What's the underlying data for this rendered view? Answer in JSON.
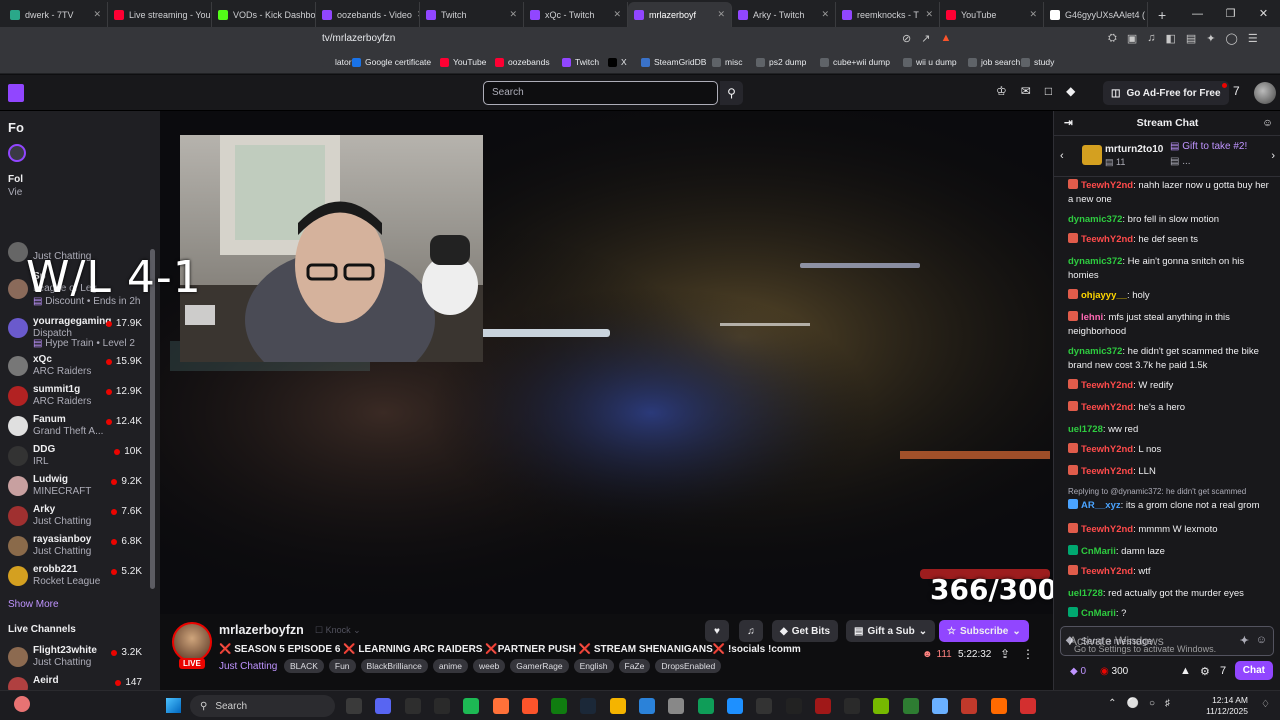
{
  "browser": {
    "tabs": [
      {
        "label": "dwerk - 7TV",
        "color": "#2aa889"
      },
      {
        "label": "Live streaming - You",
        "color": "#ff0033"
      },
      {
        "label": "VODs - Kick Dashbo",
        "color": "#53fc18"
      },
      {
        "label": "oozebands - Video",
        "color": "#9146ff"
      },
      {
        "label": "Twitch",
        "color": "#9146ff"
      },
      {
        "label": "xQc - Twitch",
        "color": "#9146ff"
      },
      {
        "label": "mrlazerboyf",
        "color": "#9146ff"
      },
      {
        "label": "Arky - Twitch",
        "color": "#9146ff"
      },
      {
        "label": "reemknocks - T",
        "color": "#9146ff"
      },
      {
        "label": "YouTube",
        "color": "#ff0033"
      },
      {
        "label": "G46gyyUXsAAlet4 (",
        "color": "#ffffff"
      }
    ],
    "url": "tv/mrlazerboyfzn",
    "bookmarks": [
      {
        "label": "lator",
        "color": "#35363a"
      },
      {
        "label": "Google certificate",
        "color": "#1a73e8"
      },
      {
        "label": "YouTube",
        "color": "#ff0033"
      },
      {
        "label": "oozebands",
        "color": "#ff0033"
      },
      {
        "label": "Twitch",
        "color": "#9146ff"
      },
      {
        "label": "X",
        "color": "#000000"
      },
      {
        "label": "SteamGridDB",
        "color": "#3a72c9"
      },
      {
        "label": "misc",
        "color": "#5f6368"
      },
      {
        "label": "ps2 dump",
        "color": "#5f6368"
      },
      {
        "label": "cube+wii dump",
        "color": "#5f6368"
      },
      {
        "label": "wii u dump",
        "color": "#5f6368"
      },
      {
        "label": "job search",
        "color": "#5f6368"
      },
      {
        "label": "study",
        "color": "#5f6368"
      }
    ]
  },
  "header": {
    "search_placeholder": "Search",
    "ad_free": "Go Ad-Free for Free"
  },
  "sidebar": {
    "followed_label": "Fo",
    "fol_label": "Fol",
    "vie_label": "Vie",
    "just_chatting_top": "Just Chatting",
    "sp_label": "Sp",
    "league": "League of Leg",
    "discount": "Discount • Ends in 2h",
    "channels": [
      {
        "name": "yourragegaming",
        "game": "Dispatch",
        "viewers": "17.9K",
        "color": "#6a5acd"
      },
      {
        "name": "xQc",
        "game": "ARC Raiders",
        "viewers": "15.9K",
        "color": "#777"
      },
      {
        "name": "summit1g",
        "game": "ARC Raiders",
        "viewers": "12.9K",
        "color": "#b22222"
      },
      {
        "name": "Fanum",
        "game": "Grand Theft A...",
        "viewers": "12.4K",
        "color": "#e0e0e0"
      },
      {
        "name": "DDG",
        "game": "IRL",
        "viewers": "10K",
        "color": "#333"
      },
      {
        "name": "Ludwig",
        "game": "MINECRAFT",
        "viewers": "9.2K",
        "color": "#c8a0a0"
      },
      {
        "name": "Arky",
        "game": "Just Chatting",
        "viewers": "7.6K",
        "color": "#a03030"
      },
      {
        "name": "rayasianboy",
        "game": "Just Chatting",
        "viewers": "6.8K",
        "color": "#8a6a4a"
      },
      {
        "name": "erobb221",
        "game": "Rocket League",
        "viewers": "5.2K",
        "color": "#d4a020"
      }
    ],
    "hype_train": "Hype Train • Level 2",
    "show_more": "Show More",
    "live_channels": "Live Channels",
    "live": [
      {
        "name": "Flight23white",
        "game": "Just Chatting",
        "viewers": "3.2K",
        "color": "#8c6a50"
      },
      {
        "name": "Aeird",
        "game": "",
        "viewers": "147",
        "color": "#b04040"
      }
    ]
  },
  "video": {
    "overlay_text": "W/L 4-1",
    "counter": "366/300"
  },
  "stream": {
    "name": "mrlazerboyfzn",
    "knock": "Knock",
    "live": "LIVE",
    "title": "❌ SEASON 5 EPISODE 6 ❌ LEARNING ARC RAIDERS ❌PARTNER PUSH ❌ STREAM SHENANIGANS❌ !socials !comm",
    "category": "Just Chatting",
    "tags": [
      "BLACK",
      "Fun",
      "BlackBrilliance",
      "anime",
      "weeb",
      "GamerRage",
      "English",
      "FaZe",
      "DropsEnabled"
    ],
    "viewers": "111",
    "uptime": "5:22:32",
    "get_bits": "Get Bits",
    "gift_sub": "Gift a Sub",
    "subscribe": "Subscribe"
  },
  "chat": {
    "title": "Stream Chat",
    "gift_user": "mrturn2to10",
    "gift_count": "11",
    "gift_cta": "Gift to take #2!",
    "gift_more": "...",
    "reply_to": "Replying to @dynamic372: he didn't get scammed",
    "messages": [
      {
        "user": "TeewhY2nd",
        "color": "#ff4b4b",
        "text": ": nahh lazer now u gotta buy her a new one",
        "badge": true
      },
      {
        "user": "dynamic372",
        "color": "#2ecc40",
        "text": ": bro fell in slow motion",
        "badge": false
      },
      {
        "user": "TeewhY2nd",
        "color": "#ff4b4b",
        "text": ": he def seen ts",
        "badge": true
      },
      {
        "user": "dynamic372",
        "color": "#2ecc40",
        "text": ": He ain't gonna snitch on his homies",
        "badge": false
      },
      {
        "user": "ohjayyy__",
        "color": "#ffd700",
        "text": ": holy",
        "badge": true
      },
      {
        "user": "lehni",
        "color": "#ff69b4",
        "text": ": mfs just steal anything in this neighborhood",
        "badge": true
      },
      {
        "user": "dynamic372",
        "color": "#2ecc40",
        "text": ": he didn't get scammed the bike brand new cost 3.7k he paid 1.5k",
        "badge": false
      },
      {
        "user": "TeewhY2nd",
        "color": "#ff4b4b",
        "text": ": W redify",
        "badge": true
      },
      {
        "user": "TeewhY2nd",
        "color": "#ff4b4b",
        "text": ": he's a hero",
        "badge": true
      },
      {
        "user": "uel1728",
        "color": "#2ecc40",
        "text": ": ww red",
        "badge": false
      },
      {
        "user": "TeewhY2nd",
        "color": "#ff4b4b",
        "text": ": L nos",
        "badge": true
      },
      {
        "user": "TeewhY2nd",
        "color": "#ff4b4b",
        "text": ": LLN",
        "badge": true
      },
      {
        "user": "AR__xyz",
        "color": "#4aa3ff",
        "text": ": its a grom clone not a real grom",
        "badge": true
      },
      {
        "user": "TeewhY2nd",
        "color": "#ff4b4b",
        "text": ": mmmm W lexmoto",
        "badge": true
      },
      {
        "user": "CnMarii",
        "color": "#2ecc40",
        "text": ": damn laze",
        "badge": true
      },
      {
        "user": "TeewhY2nd",
        "color": "#ff4b4b",
        "text": ": wtf",
        "badge": true
      },
      {
        "user": "uel1728",
        "color": "#2ecc40",
        "text": ": red actually got the murder eyes",
        "badge": false
      },
      {
        "user": "CnMarii",
        "color": "#2ecc40",
        "text": ": ?",
        "badge": true
      }
    ],
    "input_placeholder": "Send a message",
    "activate": "Activate Windows",
    "activate_sub": "Go to Settings to activate Windows.",
    "points_a": "0",
    "points_b": "300",
    "chat_button": "Chat"
  },
  "taskbar": {
    "search": "Search",
    "time": "12:14 AM",
    "date": "11/12/2025"
  }
}
